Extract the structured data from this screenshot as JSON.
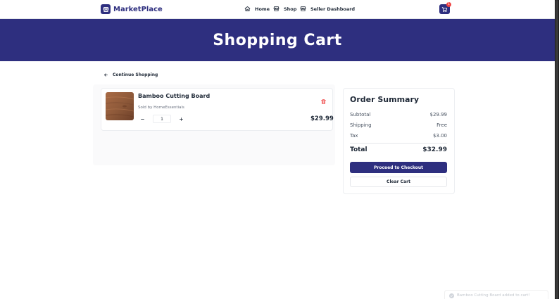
{
  "header": {
    "brand": "MarketPlace",
    "nav": [
      {
        "label": "Home",
        "icon": "home-icon"
      },
      {
        "label": "Shop",
        "icon": "store-icon"
      },
      {
        "label": "Seller Dashboard",
        "icon": "store-icon"
      }
    ],
    "cart_count": "1"
  },
  "hero": {
    "title": "Shopping Cart"
  },
  "continue_label": "Continue Shopping",
  "cart": {
    "items": [
      {
        "name": "Bamboo Cutting Board",
        "seller": "Sold by HomeEssentials",
        "quantity": "1",
        "price": "$29.99"
      }
    ]
  },
  "summary": {
    "title": "Order Summary",
    "subtotal_label": "Subtotal",
    "subtotal_value": "$29.99",
    "shipping_label": "Shipping",
    "shipping_value": "Free",
    "tax_label": "Tax",
    "tax_value": "$3.00",
    "total_label": "Total",
    "total_value": "$32.99",
    "checkout_label": "Proceed to Checkout",
    "clear_label": "Clear Cart"
  },
  "toast": {
    "message": "Bamboo Cutting Board added to cart!"
  },
  "colors": {
    "brand": "#2e2f7f",
    "badge": "#ef4444",
    "delete": "#ef4444"
  }
}
